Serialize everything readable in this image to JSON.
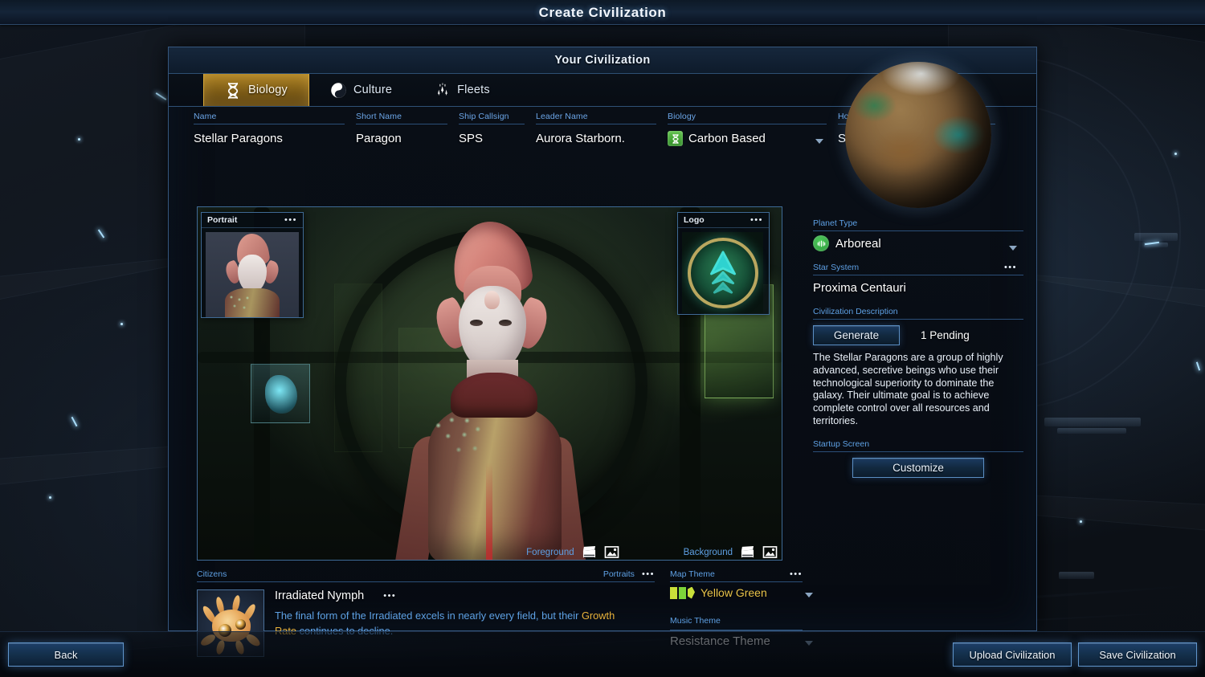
{
  "window": {
    "title": "Create Civilization"
  },
  "panel": {
    "title": "Your Civilization"
  },
  "tabs": [
    {
      "label": "Biology",
      "icon": "dna-icon",
      "active": true
    },
    {
      "label": "Culture",
      "icon": "yin-yang-icon",
      "active": false
    },
    {
      "label": "Fleets",
      "icon": "fleet-ships-icon",
      "active": false
    }
  ],
  "fields": {
    "name": {
      "label": "Name",
      "value": "Stellar Paragons"
    },
    "short_name": {
      "label": "Short Name",
      "value": "Paragon"
    },
    "ship_callsign": {
      "label": "Ship Callsign",
      "value": "SPS"
    },
    "leader_name": {
      "label": "Leader Name",
      "value": "Aurora Starborn."
    },
    "biology": {
      "label": "Biology",
      "value": "Carbon Based",
      "icon": "dna-icon"
    },
    "homeworld": {
      "label": "Homeworld Name",
      "value": "Starhaven Prime"
    }
  },
  "art": {
    "portrait_card": {
      "title": "Portrait",
      "menu": "•••"
    },
    "logo_card": {
      "title": "Logo",
      "menu": "•••"
    },
    "foreground_label": "Foreground",
    "background_label": "Background",
    "icons": {
      "slate": "film-slate-icon",
      "image": "image-picture-icon"
    }
  },
  "citizens": {
    "section_label": "Citizens",
    "portraits_label": "Portraits",
    "portraits_menu": "•••",
    "entry": {
      "name": "Irradiated Nymph",
      "menu": "•••",
      "desc_part1": "The final form of the Irradiated excels in nearly every field, but their ",
      "desc_highlight": "Growth Rate",
      "desc_part2": " continues to decline."
    }
  },
  "themes": {
    "map": {
      "label": "Map Theme",
      "menu": "•••",
      "value": "Yellow Green",
      "swatch": [
        "#c9e03a",
        "#7dd43a",
        "#c9e03a"
      ]
    },
    "music": {
      "label": "Music Theme",
      "value": "Resistance Theme"
    }
  },
  "right": {
    "planet_type": {
      "label": "Planet Type",
      "value": "Arboreal"
    },
    "star_system": {
      "label": "Star System",
      "value": "Proxima Centauri",
      "menu": "•••"
    },
    "description": {
      "label": "Civilization Description",
      "generate_label": "Generate",
      "pending_label": "1 Pending",
      "text": "The Stellar Paragons are a group of highly advanced, secretive beings who use their technological superiority to dominate the galaxy. Their ultimate goal is to achieve complete control over all resources and territories."
    },
    "startup": {
      "label": "Startup Screen",
      "customize_label": "Customize"
    }
  },
  "bottom": {
    "back": "Back",
    "upload": "Upload Civilization",
    "save": "Save Civilization"
  },
  "colors": {
    "accent_blue": "#5ea0e4",
    "gold": "#e8b13a",
    "tab_active": "#ae8324",
    "panel_border": "#35567d"
  }
}
